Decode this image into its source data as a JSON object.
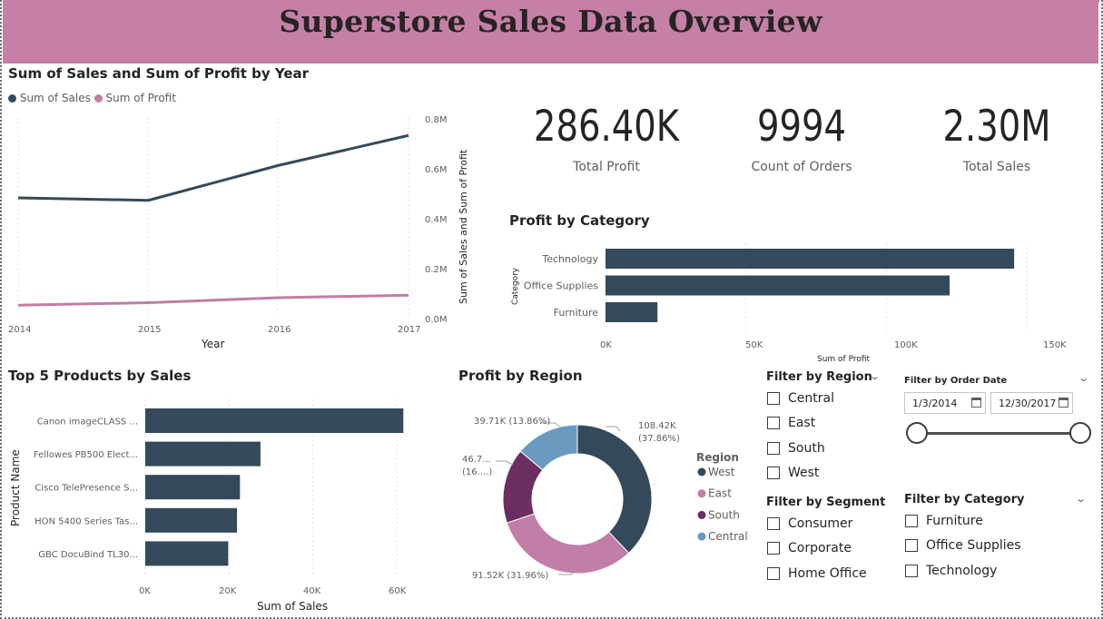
{
  "header": {
    "title": "Superstore Sales Data Overview"
  },
  "colors": {
    "banner": "#c67fa6",
    "sales": "#344a5a",
    "profit": "#c17ea6",
    "west": "#344a5a",
    "east": "#c17ea6",
    "south": "#6a2e61",
    "central": "#6b9ac0"
  },
  "line_chart": {
    "title": "Sum of Sales and Sum of Profit by Year",
    "legend": [
      "Sum of Sales",
      "Sum of Profit"
    ],
    "xlabel": "Year",
    "ylabel": "Sum of Sales and Sum of Profit",
    "x_ticks": [
      "2014",
      "2015",
      "2016",
      "2017"
    ],
    "y_ticks": [
      "0.0M",
      "0.2M",
      "0.4M",
      "0.6M",
      "0.8M"
    ]
  },
  "kpis": [
    {
      "value": "286.40K",
      "label": "Total Profit"
    },
    {
      "value": "9994",
      "label": "Count of Orders"
    },
    {
      "value": "2.30M",
      "label": "Total Sales"
    }
  ],
  "category_chart": {
    "title": "Profit by Category",
    "ylabel": "Category",
    "xlabel": "Sum of Profit",
    "x_ticks": [
      "0K",
      "50K",
      "100K",
      "150K"
    ]
  },
  "products_chart": {
    "title": "Top 5 Products by Sales",
    "ylabel": "Product Name",
    "xlabel": "Sum of Sales",
    "x_ticks": [
      "0K",
      "20K",
      "40K",
      "60K"
    ]
  },
  "region_chart": {
    "title": "Profit by Region",
    "legend_title": "Region",
    "labels": [
      {
        "line1": "108.42K",
        "line2": "(37.86%)"
      },
      {
        "line1": "91.52K (31.96%)",
        "line2": ""
      },
      {
        "line1": "46.7...",
        "line2": "(16....)"
      },
      {
        "line1": "39.71K (13.86%)",
        "line2": ""
      }
    ]
  },
  "filters": {
    "region": {
      "title": "Filter by Region",
      "options": [
        "Central",
        "East",
        "South",
        "West"
      ]
    },
    "segment": {
      "title": "Filter by Segment",
      "options": [
        "Consumer",
        "Corporate",
        "Home Office"
      ]
    },
    "date": {
      "title": "Filter by Order Date",
      "start": "1/3/2014",
      "end": "12/30/2017",
      "range_start_fraction": 0,
      "range_end_fraction": 1
    },
    "category": {
      "title": "Filter by Category",
      "options": [
        "Furniture",
        "Office Supplies",
        "Technology"
      ]
    }
  },
  "chart_data": [
    {
      "type": "line",
      "title": "Sum of Sales and Sum of Profit by Year",
      "xlabel": "Year",
      "ylabel": "Sum of Sales and Sum of Profit",
      "x": [
        2014,
        2015,
        2016,
        2017
      ],
      "ylim": [
        0,
        0.8
      ],
      "series": [
        {
          "name": "Sum of Sales",
          "values": [
            0.48,
            0.47,
            0.61,
            0.73
          ]
        },
        {
          "name": "Sum of Profit",
          "values": [
            0.05,
            0.06,
            0.08,
            0.09
          ]
        }
      ],
      "legend": "top-left"
    },
    {
      "type": "bar",
      "orientation": "horizontal",
      "title": "Profit by Category",
      "xlabel": "Sum of Profit",
      "ylabel": "Category",
      "categories": [
        "Technology",
        "Office Supplies",
        "Furniture"
      ],
      "values": [
        145.5,
        122.5,
        18.5
      ],
      "xlim": [
        0,
        160
      ]
    },
    {
      "type": "bar",
      "orientation": "horizontal",
      "title": "Top 5 Products by Sales",
      "xlabel": "Sum of Sales",
      "ylabel": "Product Name",
      "categories": [
        "Canon imageCLASS ...",
        "Fellowes PB500 Elect...",
        "Cisco TelePresence S...",
        "HON 5400 Series Tas...",
        "GBC DocuBind TL30..."
      ],
      "values": [
        61.6,
        27.5,
        22.6,
        21.9,
        19.8
      ],
      "xlim": [
        0,
        65
      ]
    },
    {
      "type": "pie",
      "title": "Profit by Region",
      "categories": [
        "West",
        "East",
        "South",
        "Central"
      ],
      "values": [
        108.42,
        91.52,
        46.7,
        39.71
      ],
      "legend": "right"
    }
  ]
}
